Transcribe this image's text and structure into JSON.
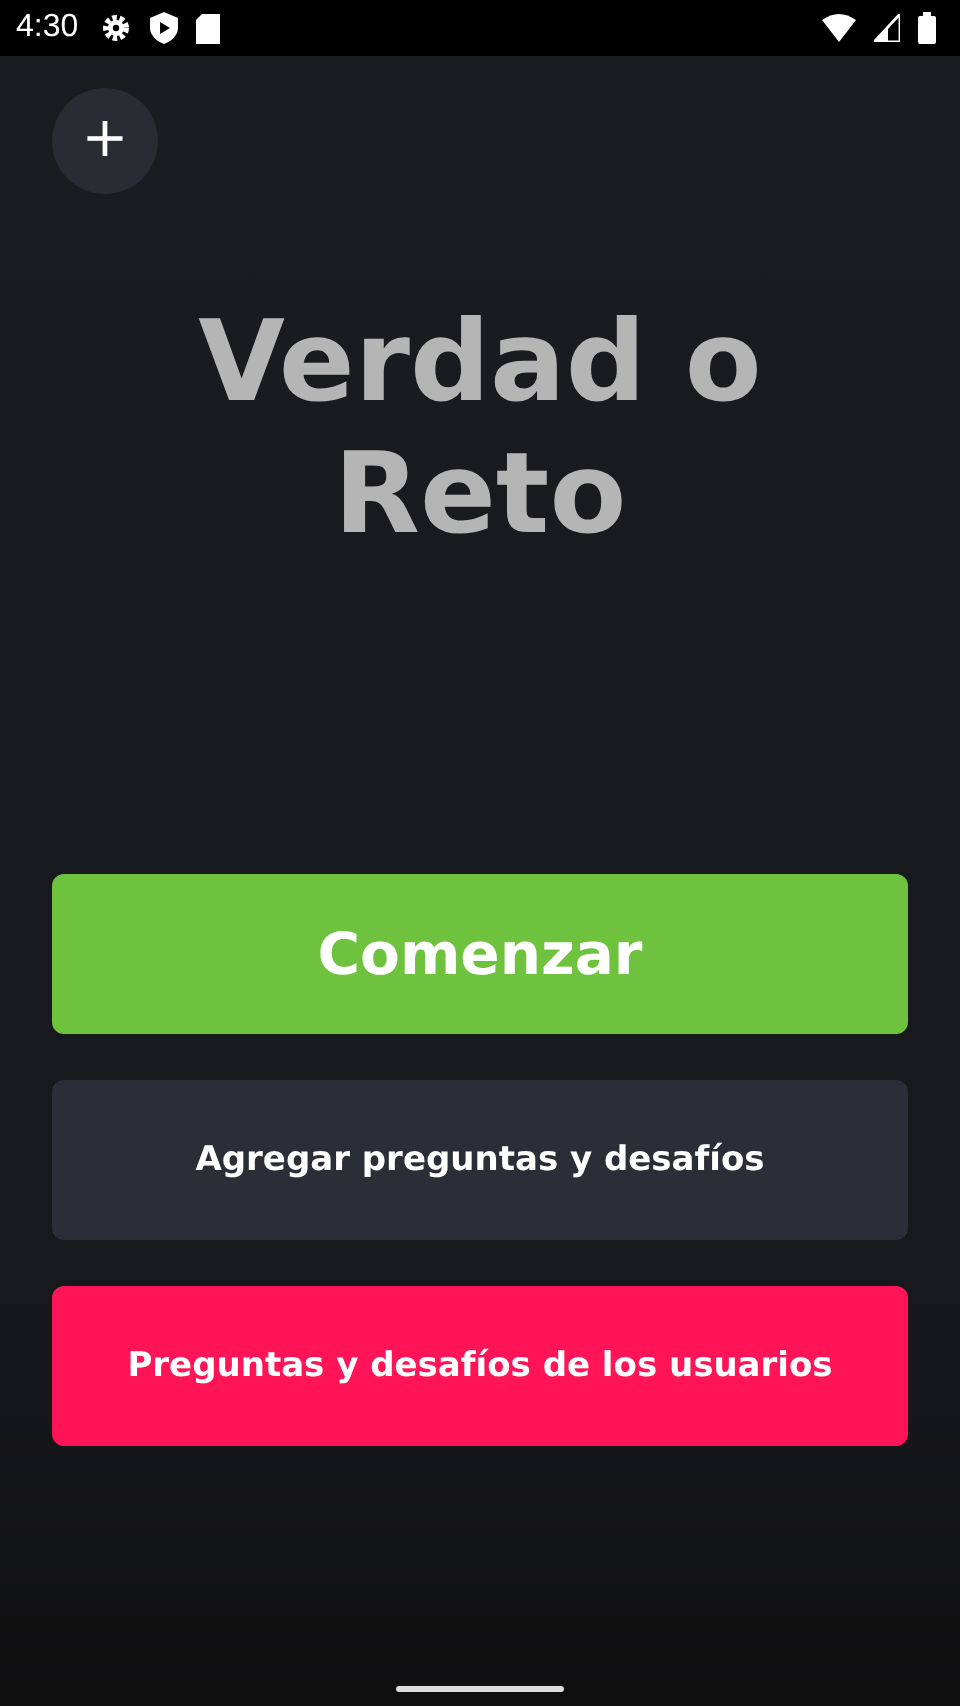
{
  "status_bar": {
    "time": "4:30"
  },
  "add_button": {
    "label": "+"
  },
  "title": "Verdad o Reto",
  "buttons": [
    {
      "label": "Comenzar",
      "kind": "primary"
    },
    {
      "label": "Agregar preguntas y desafíos",
      "kind": "secondary"
    },
    {
      "label": "Preguntas y desafíos de los usuarios",
      "kind": "accent"
    }
  ]
}
